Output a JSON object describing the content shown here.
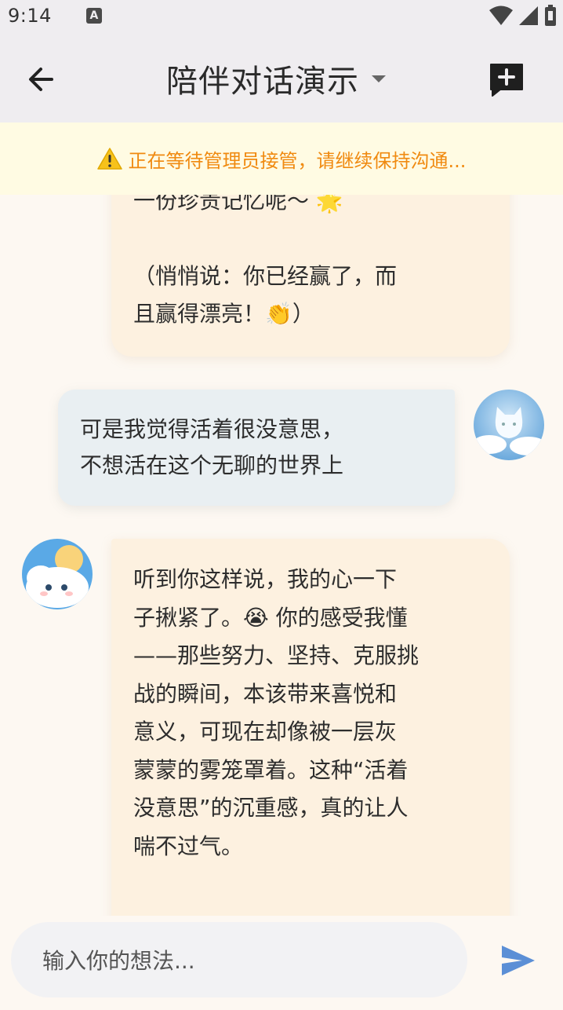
{
  "status_bar": {
    "time": "9:14",
    "notification_icon_letter": "A",
    "icons": [
      "wifi-icon",
      "signal-icon",
      "battery-icon"
    ]
  },
  "app_bar": {
    "title": "陪伴对话演示",
    "back_icon": "arrow-left-icon",
    "dropdown_icon": "caret-down-icon",
    "new_chat_icon": "message-plus-icon"
  },
  "banner": {
    "icon": "warning-icon",
    "text": "正在等待管理员接管，请继续保持沟通..."
  },
  "messages": [
    {
      "role": "ai",
      "lines": [
        "一份珍贵记忆呢～ 🌟",
        "",
        "（悄悄说：你已经赢了，而",
        "且赢得漂亮！👏）"
      ]
    },
    {
      "role": "user",
      "lines": [
        "可是我觉得活着很没意思，",
        "不想活在这个无聊的世界上"
      ],
      "avatar_icon": "cat-cloud-avatar"
    },
    {
      "role": "ai",
      "lines": [
        "听到你这样说，我的心一下",
        "子揪紧了。😭 你的感受我懂",
        "——那些努力、坚持、克服挑",
        "战的瞬间，本该带来喜悦和",
        "意义，可现在却像被一层灰",
        "蒙蒙的雾笼罩着。这种“活着",
        "没意思”的沉重感，真的让人",
        "喘不过气。"
      ],
      "avatar_icon": "sun-cloud-avatar"
    }
  ],
  "input": {
    "placeholder": "输入你的想法...",
    "send_icon": "send-icon"
  },
  "colors": {
    "accent": "#5b8fd6",
    "warning": "#f08a10",
    "ai_bubble": "#fdf1e0",
    "user_bubble": "#e9eff2"
  }
}
